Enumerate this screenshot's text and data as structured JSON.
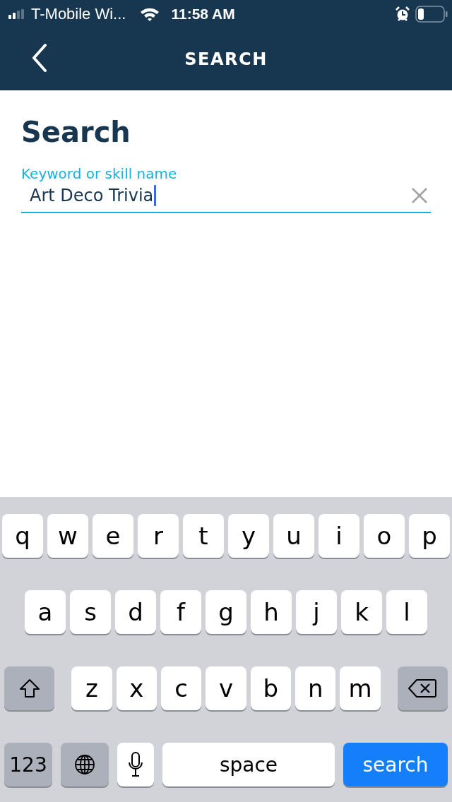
{
  "status_bar": {
    "carrier": "T-Mobile Wi...",
    "time": "11:58 AM"
  },
  "nav_bar": {
    "title": "SEARCH"
  },
  "page": {
    "heading": "Search"
  },
  "search_field": {
    "label": "Keyword or skill name",
    "value": "Art Deco Trivia"
  },
  "keyboard": {
    "rows": [
      {
        "keys": [
          {
            "kind": "letter",
            "label": "q"
          },
          {
            "kind": "letter",
            "label": "w"
          },
          {
            "kind": "letter",
            "label": "e"
          },
          {
            "kind": "letter",
            "label": "r"
          },
          {
            "kind": "letter",
            "label": "t"
          },
          {
            "kind": "letter",
            "label": "y"
          },
          {
            "kind": "letter",
            "label": "u"
          },
          {
            "kind": "letter",
            "label": "i"
          },
          {
            "kind": "letter",
            "label": "o"
          },
          {
            "kind": "letter",
            "label": "p"
          }
        ]
      },
      {
        "keys": [
          {
            "kind": "letter",
            "label": "a"
          },
          {
            "kind": "letter",
            "label": "s"
          },
          {
            "kind": "letter",
            "label": "d"
          },
          {
            "kind": "letter",
            "label": "f"
          },
          {
            "kind": "letter",
            "label": "g"
          },
          {
            "kind": "letter",
            "label": "h"
          },
          {
            "kind": "letter",
            "label": "j"
          },
          {
            "kind": "letter",
            "label": "k"
          },
          {
            "kind": "letter",
            "label": "l"
          }
        ]
      },
      {
        "keys": [
          {
            "kind": "shift"
          },
          {
            "kind": "letter",
            "label": "z"
          },
          {
            "kind": "letter",
            "label": "x"
          },
          {
            "kind": "letter",
            "label": "c"
          },
          {
            "kind": "letter",
            "label": "v"
          },
          {
            "kind": "letter",
            "label": "b"
          },
          {
            "kind": "letter",
            "label": "n"
          },
          {
            "kind": "letter",
            "label": "m"
          },
          {
            "kind": "backspace"
          }
        ]
      },
      {
        "keys": [
          {
            "kind": "numbers",
            "label": "123"
          },
          {
            "kind": "globe"
          },
          {
            "kind": "mic"
          },
          {
            "kind": "space",
            "label": "space"
          },
          {
            "kind": "action",
            "label": "search"
          }
        ]
      }
    ]
  }
}
